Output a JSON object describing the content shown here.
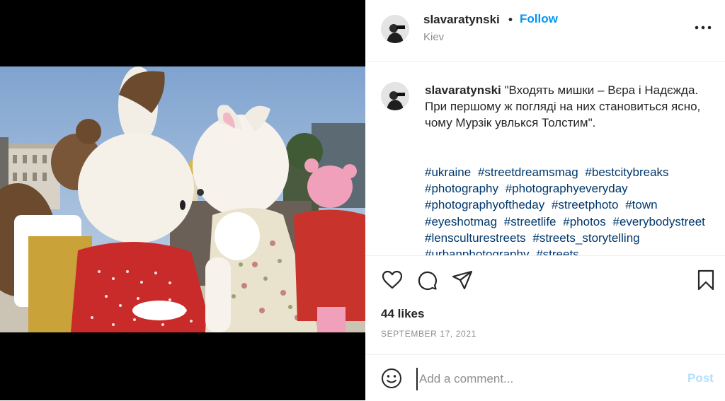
{
  "post": {
    "username": "slavaratynski",
    "separator": "•",
    "follow_label": "Follow",
    "location": "Kiev",
    "more_icon": "more-horizontal-icon"
  },
  "caption": {
    "username": "slavaratynski",
    "text": "\"Входять мишки – Вєра і Надєжда. При першому ж погляді на них становиться ясно, чому Мурзік увлькся Толстим\".",
    "hashtags": [
      "#ukraine",
      "#streetdreamsmag",
      "#bestcitybreaks",
      "#photography",
      "#photographyeveryday",
      "#photographyoftheday",
      "#streetphoto",
      "#town",
      "#eyeshotmag",
      "#streetlife",
      "#photos",
      "#everybodystreet",
      "#lensculturestreets",
      "#streets_storytelling",
      "#urbanphotography",
      "#streets"
    ]
  },
  "actions": {
    "icons": [
      "heart-icon",
      "comment-icon",
      "share-icon",
      "bookmark-icon"
    ],
    "likes": "44 likes",
    "date": "SEPTEMBER 17, 2021"
  },
  "comment": {
    "placeholder": "Add a comment...",
    "post_label": "Post",
    "emoji_icon": "emoji-icon"
  },
  "colors": {
    "follow": "#0095f6",
    "hashtag": "#00376b",
    "post_disabled": "#b2dffc",
    "muted": "#8e8e8e",
    "text": "#262626"
  }
}
